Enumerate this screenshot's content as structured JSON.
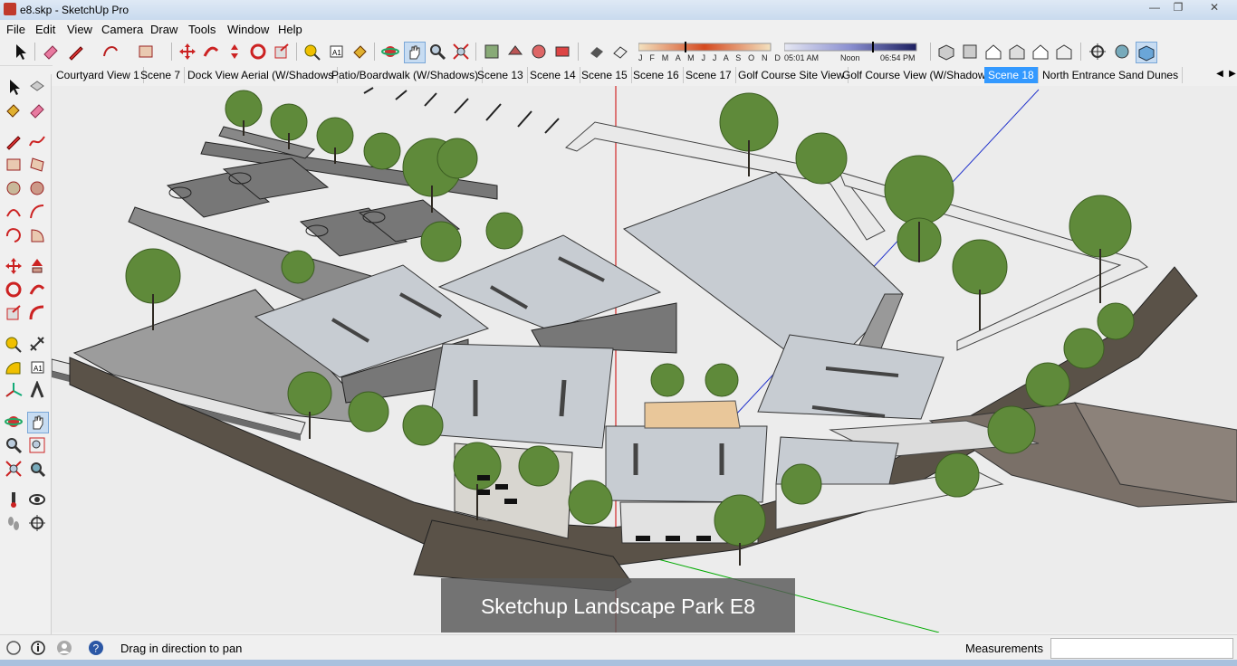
{
  "window": {
    "title": "e8.skp - SketchUp Pro",
    "buttons": [
      "minimize",
      "restore",
      "close"
    ]
  },
  "menu": [
    "File",
    "Edit",
    "View",
    "Camera",
    "Draw",
    "Tools",
    "Window",
    "Help"
  ],
  "shadow": {
    "months": "J F M A M J J A S O N D",
    "time_start": "05:01 AM",
    "time_noon": "Noon",
    "time_end": "06:54 PM"
  },
  "scenes": {
    "tabs": [
      "Courtyard View 1",
      "Scene 7",
      "Dock View Aerial (W/Shadows",
      "Patio/Boardwalk (W/Shadows)",
      "Scene 13",
      "Scene 14",
      "Scene 15",
      "Scene 16",
      "Scene 17",
      "Golf Course Site View",
      "Golf Course View (W/Shadows)",
      "Scene 18",
      "North Entrance Sand Dunes"
    ],
    "active": "Scene 18"
  },
  "viewport": {
    "caption": "Sketchup Landscape Park E8"
  },
  "status": {
    "hint": "Drag in direction to pan",
    "measurements_label": "Measurements",
    "measurements_value": ""
  },
  "colors": {
    "active_tab": "#3399ff",
    "axis_red": "#cc0000",
    "axis_green": "#00aa00",
    "axis_blue": "#0000cc",
    "roof": "#c7ccd2",
    "tree": "#5f8a3a"
  },
  "icons": {
    "toolbar": [
      "select-icon",
      "eraser-icon",
      "pencil-icon",
      "shape-icon",
      "rectangle-icon",
      "move-icon",
      "follow-me-icon",
      "push-pull-icon",
      "rotate-icon",
      "scale-icon",
      "tape-icon",
      "text-icon",
      "paint-icon",
      "orbit-icon",
      "pan-icon",
      "zoom-icon",
      "zoom-extents-icon",
      "components-icon",
      "materials-icon",
      "styles-icon",
      "scenes-icon",
      "shadows-icon",
      "fog-icon",
      "iso-view-icon",
      "top-view-icon",
      "front-view-icon",
      "right-view-icon",
      "back-view-icon",
      "left-view-icon",
      "position-camera-icon",
      "look-around-icon",
      "walk-icon"
    ]
  }
}
